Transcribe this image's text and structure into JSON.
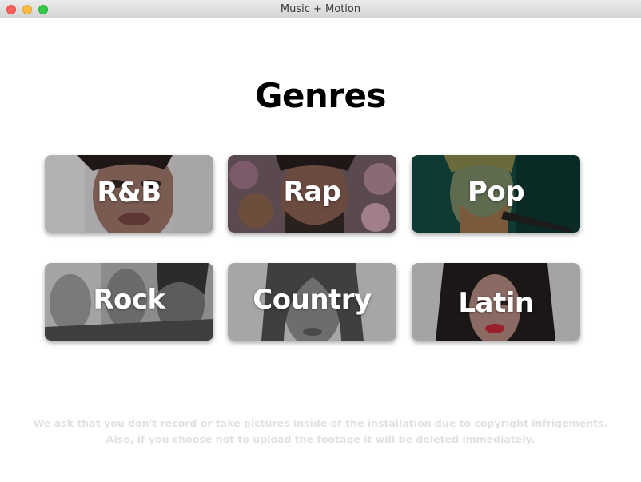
{
  "window": {
    "title": "Music + Motion"
  },
  "main": {
    "heading": "Genres",
    "genres": [
      {
        "label": "R&B"
      },
      {
        "label": "Rap"
      },
      {
        "label": "Pop"
      },
      {
        "label": "Rock"
      },
      {
        "label": "Country"
      },
      {
        "label": "Latin"
      }
    ],
    "notice": "We ask that you don't record or take pictures inside of the installation due to copyright infrigements. Also, if you choose not to upload the footage it will be deleted immediately."
  }
}
